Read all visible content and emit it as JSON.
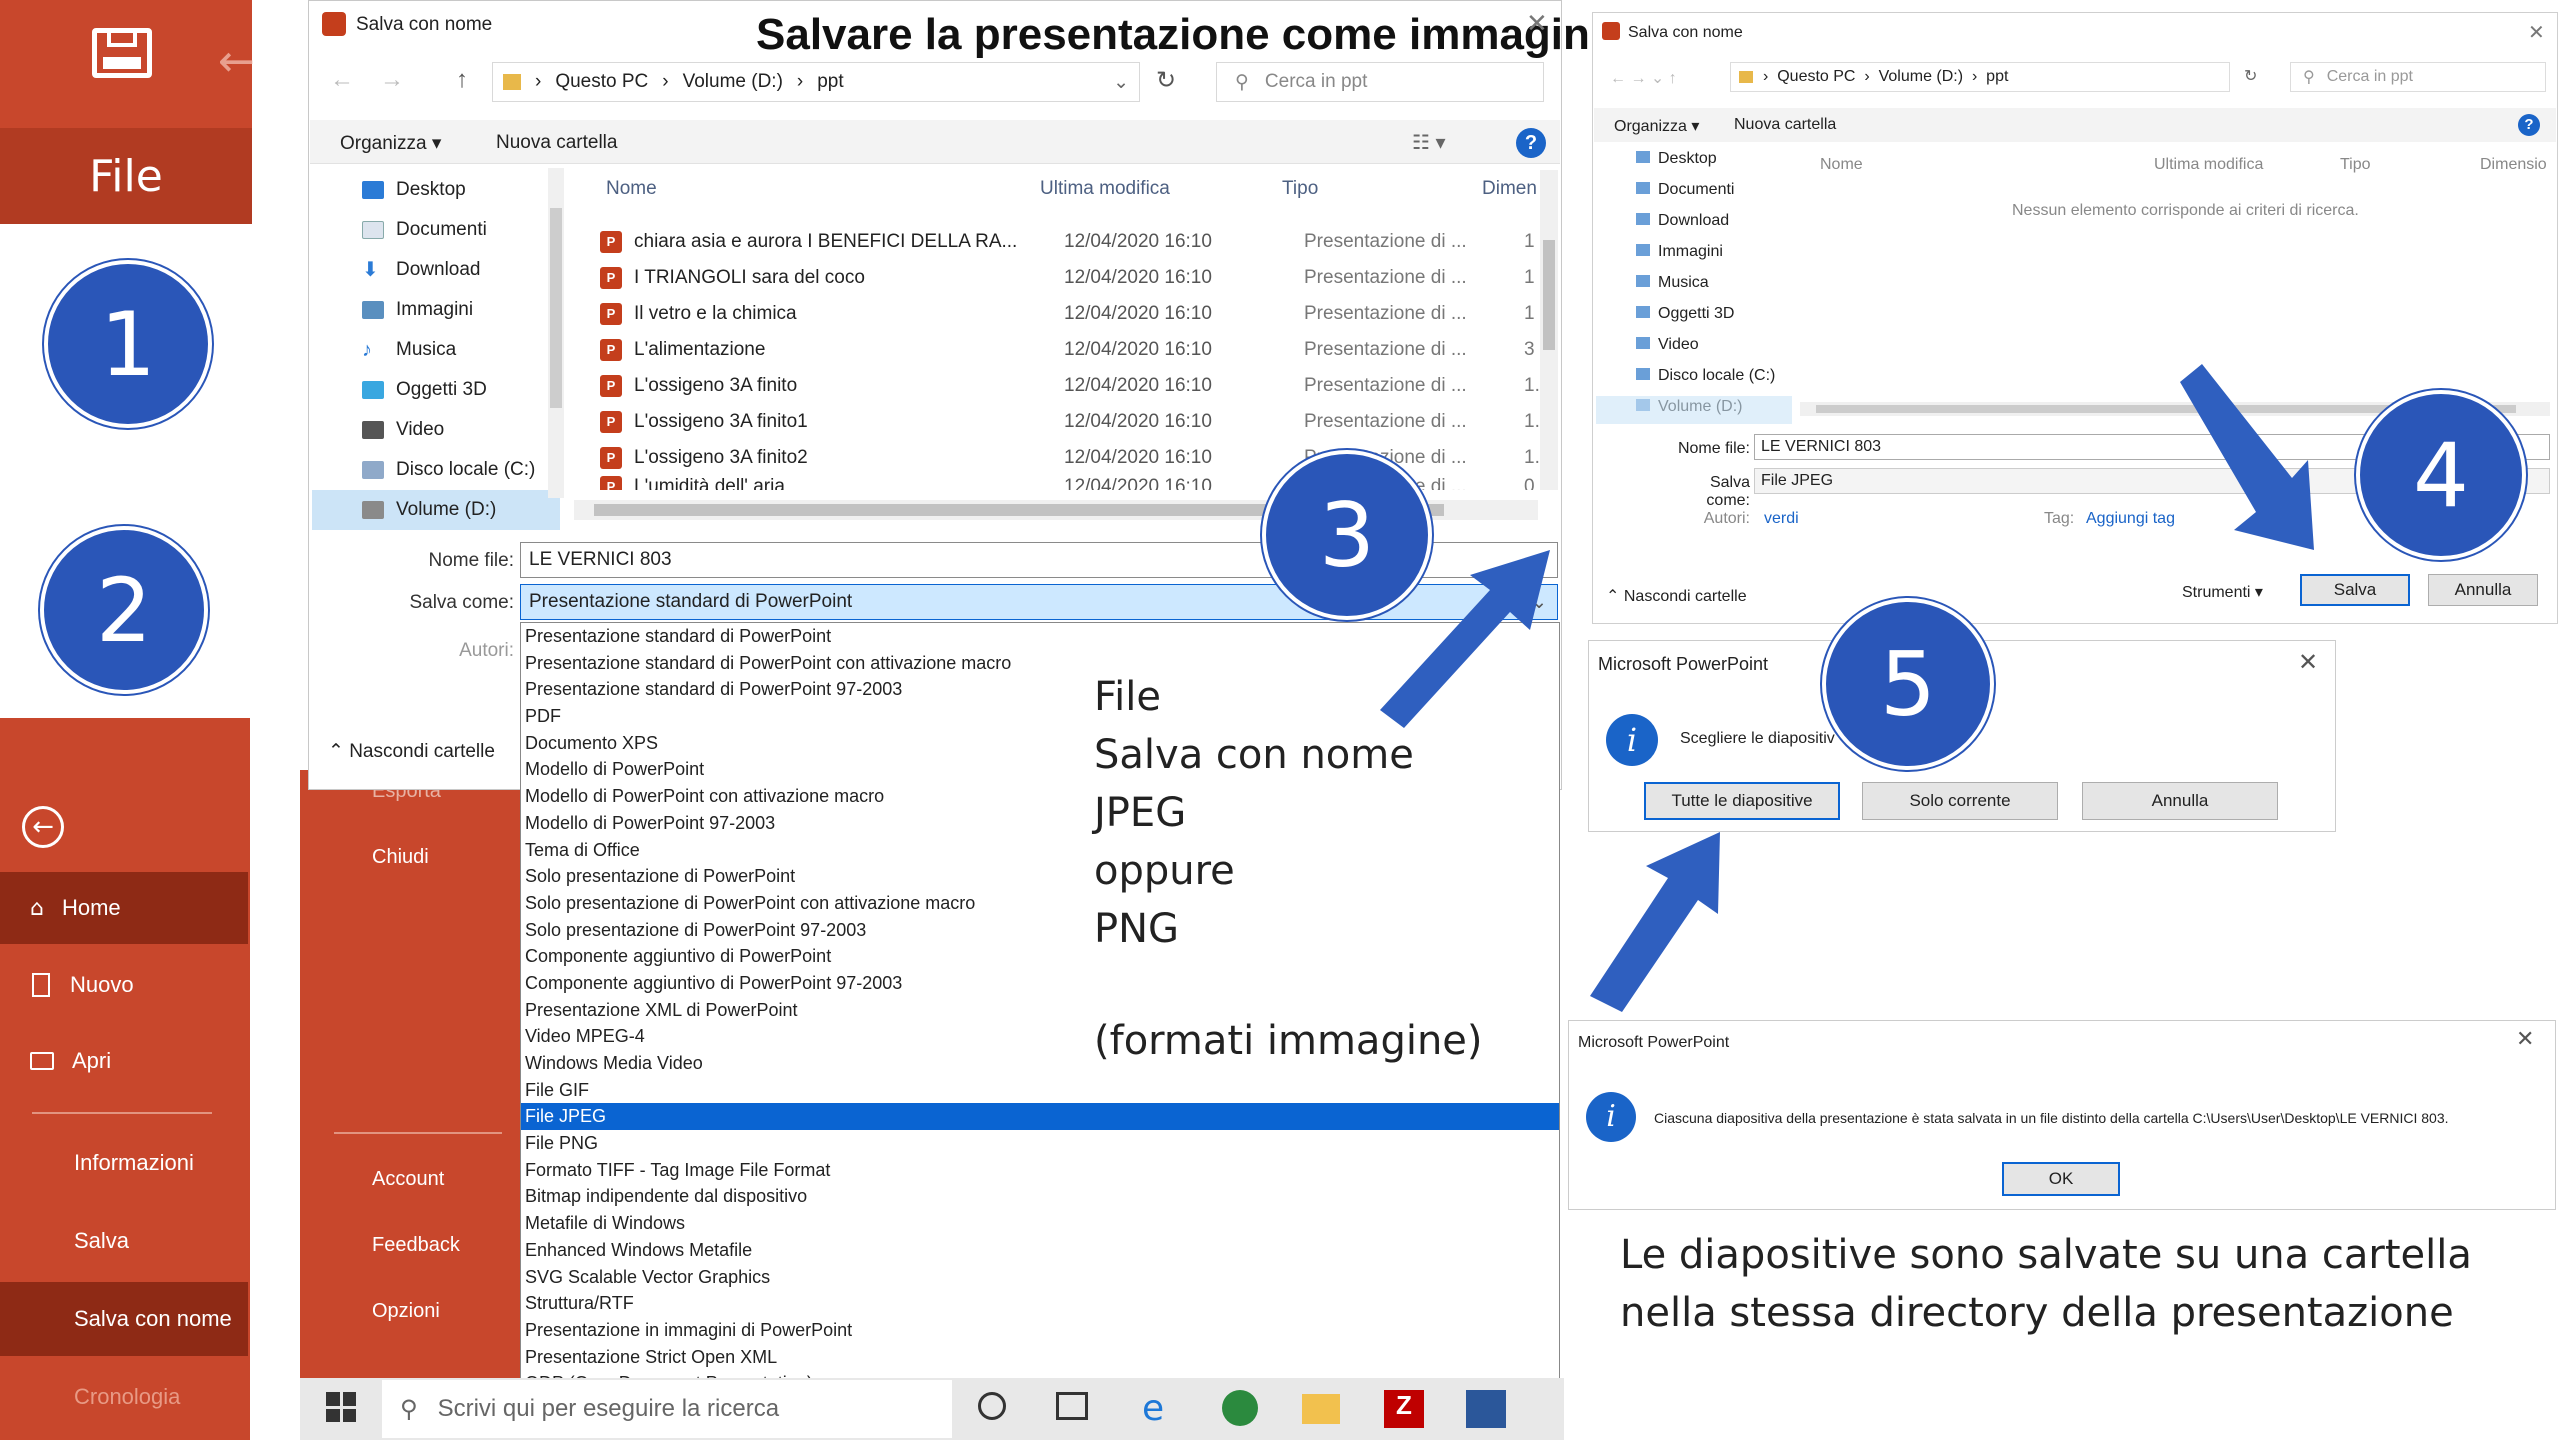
{
  "title": "Salvare la presentazione come immagini",
  "pp": {
    "file_label": "File",
    "menu": [
      {
        "label": "Home"
      },
      {
        "label": "Nuovo"
      },
      {
        "label": "Apri"
      },
      {
        "label": "Informazioni"
      },
      {
        "label": "Salva"
      },
      {
        "label": "Salva con nome"
      },
      {
        "label": "Cronologia"
      }
    ],
    "mid": [
      {
        "label": "Esporta"
      },
      {
        "label": "Chiudi"
      },
      {
        "label": "Account"
      },
      {
        "label": "Feedback"
      },
      {
        "label": "Opzioni"
      }
    ]
  },
  "steps": [
    "1",
    "2",
    "3",
    "4",
    "5"
  ],
  "dlg1": {
    "title": "Salva con nome",
    "breadcrumb": [
      "Questo PC",
      "Volume (D:)",
      "ppt"
    ],
    "search_placeholder": "Cerca in ppt",
    "organize": "Organizza ▾",
    "new_folder": "Nuova cartella",
    "help": "?",
    "nav": [
      {
        "label": "Desktop"
      },
      {
        "label": "Documenti"
      },
      {
        "label": "Download"
      },
      {
        "label": "Immagini"
      },
      {
        "label": "Musica"
      },
      {
        "label": "Oggetti 3D"
      },
      {
        "label": "Video"
      },
      {
        "label": "Disco locale (C:)"
      },
      {
        "label": "Volume (D:)"
      }
    ],
    "cols": [
      "Nome",
      "Ultima modifica",
      "Tipo",
      "Dimen"
    ],
    "files": [
      {
        "name": "chiara asia e aurora I BENEFICI DELLA RA...",
        "date": "12/04/2020 16:10",
        "type": "Presentazione di ...",
        "size": "1"
      },
      {
        "name": "I TRIANGOLI sara del coco",
        "date": "12/04/2020 16:10",
        "type": "Presentazione di ...",
        "size": "1"
      },
      {
        "name": "Il vetro e la chimica",
        "date": "12/04/2020 16:10",
        "type": "Presentazione di ...",
        "size": "1"
      },
      {
        "name": "L'alimentazione",
        "date": "12/04/2020 16:10",
        "type": "Presentazione di ...",
        "size": "3"
      },
      {
        "name": "L'ossigeno 3A finito",
        "date": "12/04/2020 16:10",
        "type": "Presentazione di ...",
        "size": "1.0"
      },
      {
        "name": "L'ossigeno 3A finito1",
        "date": "12/04/2020 16:10",
        "type": "Presentazione di ...",
        "size": "1.0"
      },
      {
        "name": "L'ossigeno 3A finito2",
        "date": "12/04/2020 16:10",
        "type": "Presentazione di ...",
        "size": "1.0"
      },
      {
        "name": "L'umidità dell' aria",
        "date": "12/04/2020 16:10",
        "type": "Presentazione di ...",
        "size": "0"
      }
    ],
    "filename_label": "Nome file:",
    "filename_value": "LE VERNICI 803",
    "saveas_label": "Salva come:",
    "saveas_value": "Presentazione standard di PowerPoint",
    "author_label": "Autori:",
    "hide_folders": "Nascondi cartelle",
    "options": [
      "Presentazione standard di PowerPoint",
      "Presentazione standard di PowerPoint con attivazione macro",
      "Presentazione standard di PowerPoint 97-2003",
      "PDF",
      "Documento XPS",
      "Modello di PowerPoint",
      "Modello di PowerPoint con attivazione macro",
      "Modello di PowerPoint 97-2003",
      "Tema di Office",
      "Solo presentazione di PowerPoint",
      "Solo presentazione di PowerPoint con attivazione macro",
      "Solo presentazione di PowerPoint 97-2003",
      "Componente aggiuntivo di PowerPoint",
      "Componente aggiuntivo di PowerPoint 97-2003",
      "Presentazione XML di PowerPoint",
      "Video MPEG-4",
      "Windows Media Video",
      "File GIF",
      "File JPEG",
      "File PNG",
      "Formato TIFF - Tag Image File Format",
      "Bitmap indipendente dal dispositivo",
      "Metafile di Windows",
      "Enhanced Windows Metafile",
      "SVG Scalable Vector Graphics",
      "Struttura/RTF",
      "Presentazione in immagini di PowerPoint",
      "Presentazione Strict Open XML",
      "ODP (OpenDocument Presentation)"
    ],
    "selected_option": "File JPEG"
  },
  "note": [
    "File",
    "Salva con nome",
    "JPEG",
    "oppure",
    "PNG",
    "(formati immagine)"
  ],
  "taskbar": {
    "search": "Scrivi qui per eseguire la ricerca"
  },
  "dlg2": {
    "title": "Salva con nome",
    "breadcrumb": [
      "Questo PC",
      "Volume (D:)",
      "ppt"
    ],
    "search_placeholder": "Cerca in ppt",
    "organize": "Organizza ▾",
    "new_folder": "Nuova cartella",
    "nav": [
      {
        "label": "Desktop"
      },
      {
        "label": "Documenti"
      },
      {
        "label": "Download"
      },
      {
        "label": "Immagini"
      },
      {
        "label": "Musica"
      },
      {
        "label": "Oggetti 3D"
      },
      {
        "label": "Video"
      },
      {
        "label": "Disco locale (C:)"
      },
      {
        "label": "Volume (D:)"
      }
    ],
    "cols": [
      "Nome",
      "Ultima modifica",
      "Tipo",
      "Dimensio"
    ],
    "empty": "Nessun elemento corrisponde ai criteri di ricerca.",
    "filename_label": "Nome file:",
    "filename_value": "LE VERNICI 803",
    "saveas_label": "Salva come:",
    "saveas_value": "File JPEG",
    "author_label": "Autori:",
    "author_value": "verdi",
    "tag_label": "Tag:",
    "tag_value": "Aggiungi tag",
    "hide_folders": "Nascondi cartelle",
    "tools": "Strumenti",
    "save": "Salva",
    "cancel": "Annulla"
  },
  "dlg3": {
    "title": "Microsoft PowerPoint",
    "text": "Scegliere le diapositiv",
    "btn_all": "Tutte le diapositive",
    "btn_current": "Solo corrente",
    "btn_cancel": "Annulla"
  },
  "dlg4": {
    "title": "Microsoft PowerPoint",
    "text": "Ciascuna diapositiva della presentazione è stata salvata in un file distinto della cartella C:\\Users\\User\\Desktop\\LE VERNICI 803.",
    "ok": "OK"
  },
  "caption": [
    "Le diapositive sono salvate su una cartella",
    "nella stessa directory della presentazione"
  ]
}
